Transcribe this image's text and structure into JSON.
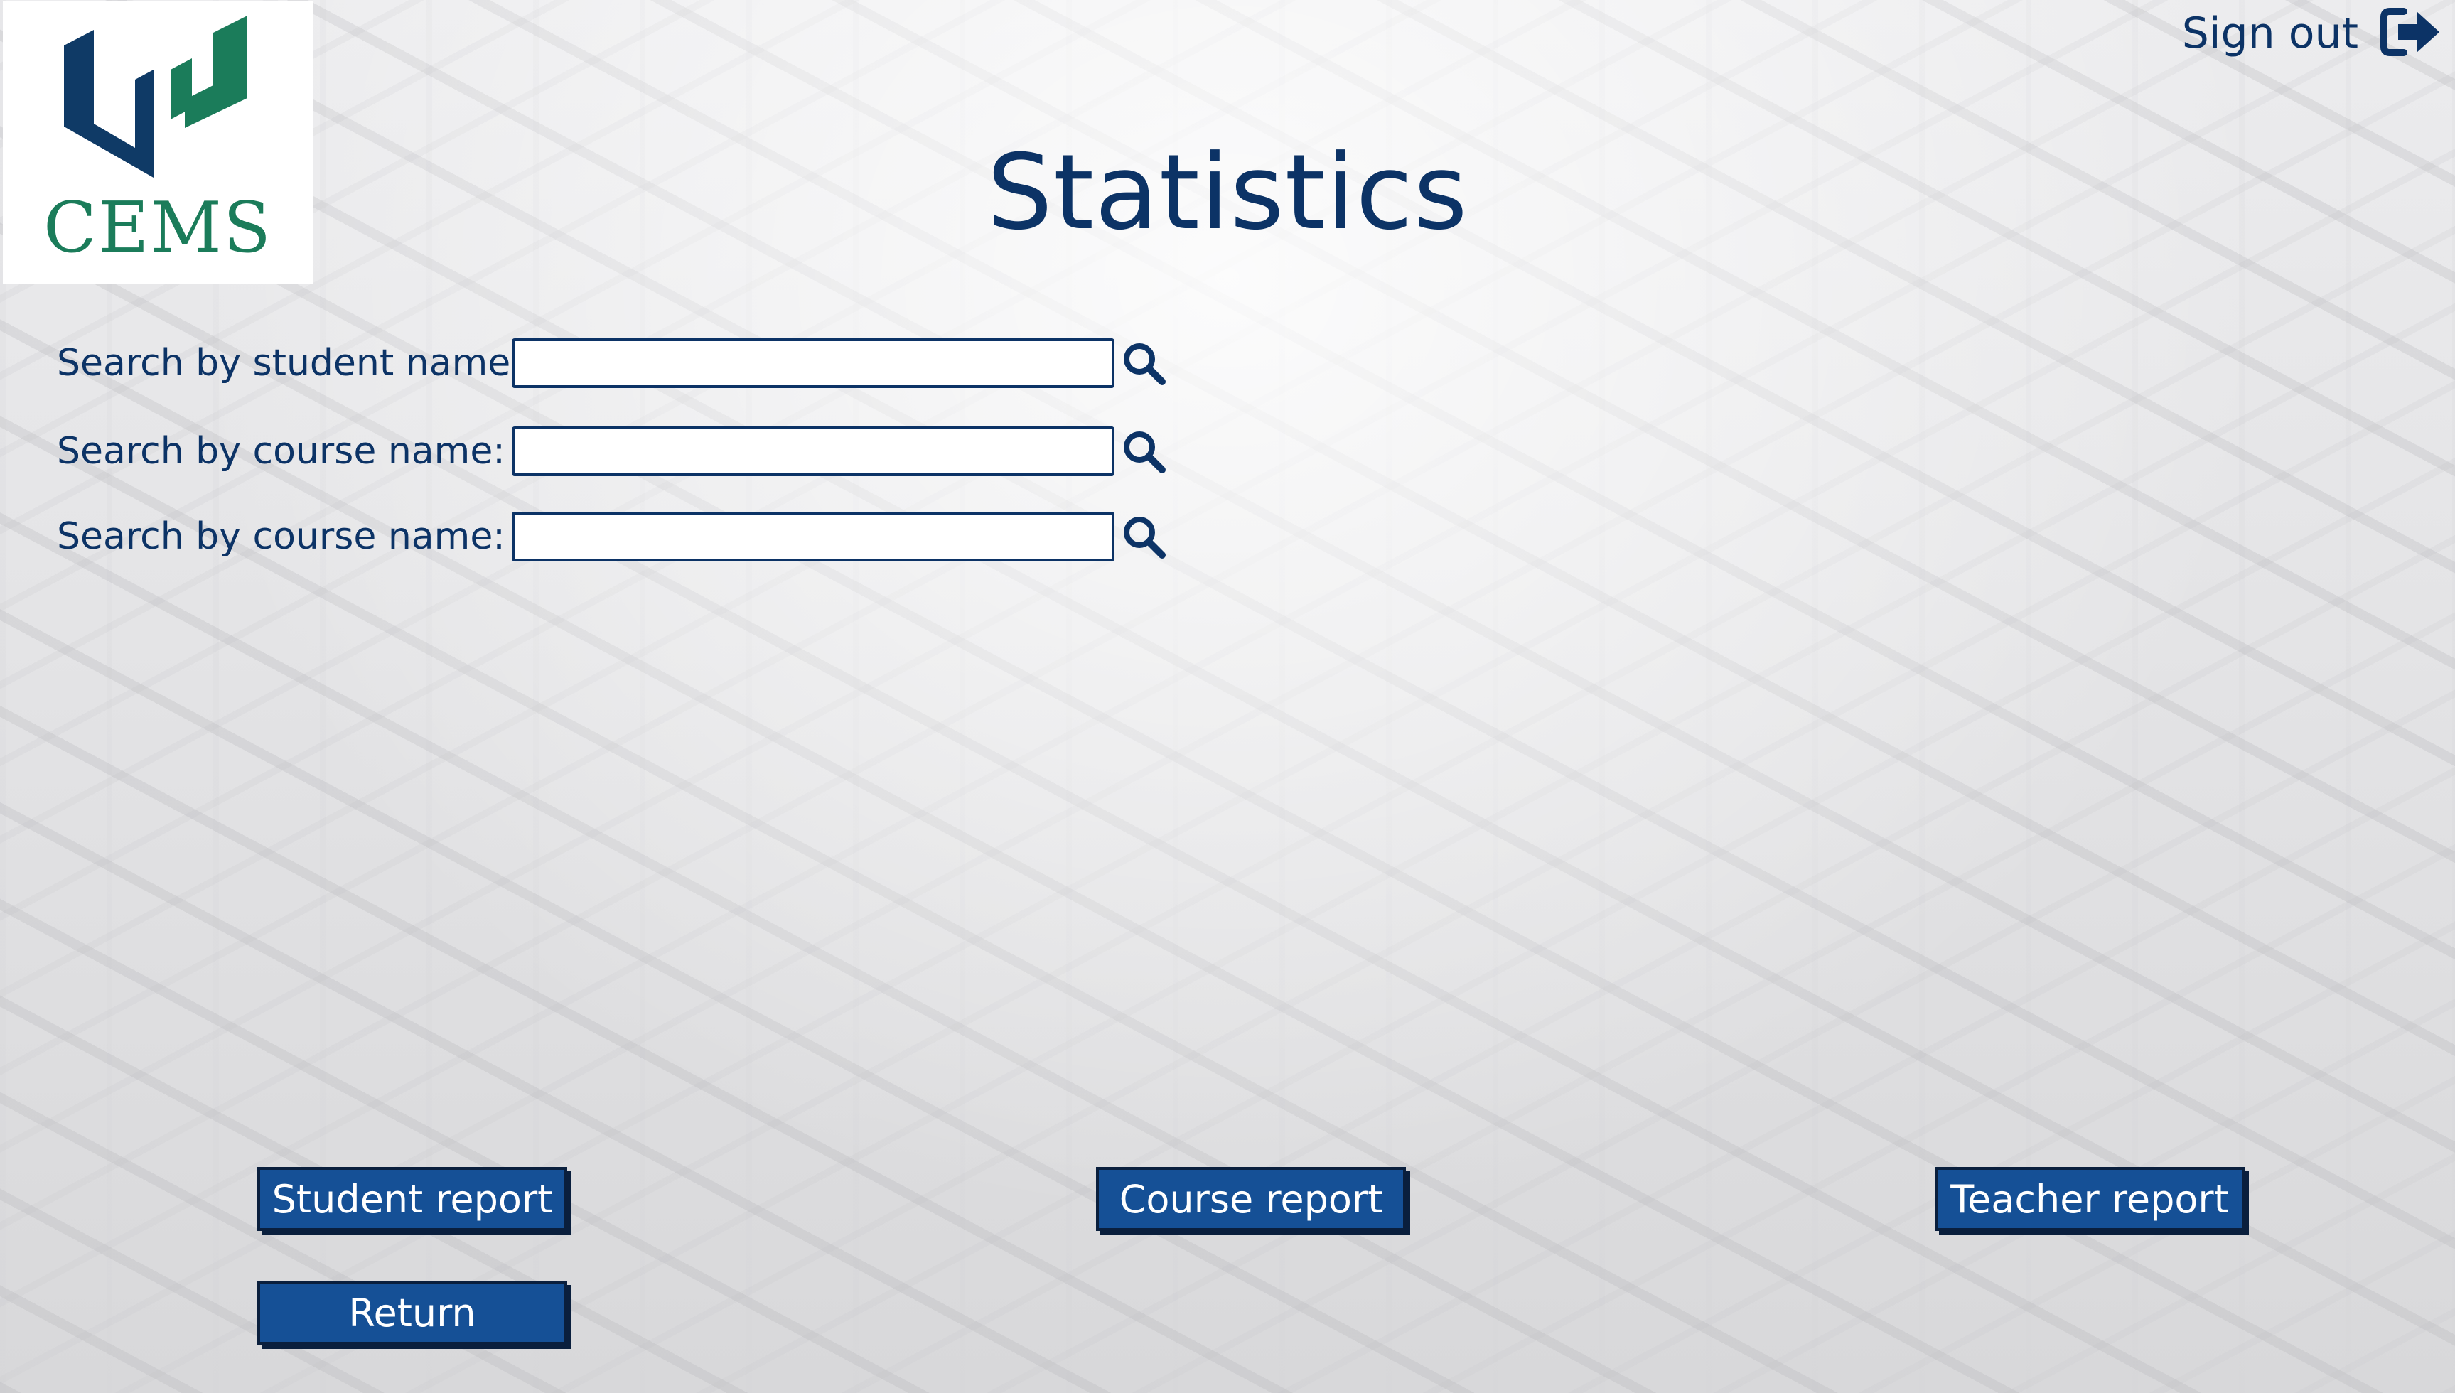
{
  "logo": {
    "text": "CEMS",
    "icon": "cems-logo-icon"
  },
  "header": {
    "title": "Statistics",
    "signout_label": "Sign out",
    "signout_icon": "sign-out-icon"
  },
  "search": {
    "rows": [
      {
        "label": "Search by student name:",
        "value": "",
        "icon": "search-icon"
      },
      {
        "label": "Search by course name:",
        "value": "",
        "icon": "search-icon"
      },
      {
        "label": "Search by course name:",
        "value": "",
        "icon": "search-icon"
      }
    ]
  },
  "buttons": {
    "student_report": "Student report",
    "course_report": "Course report",
    "teacher_report": "Teacher report",
    "return": "Return"
  },
  "colors": {
    "primary_text": "#0c3366",
    "button_bg": "#155096",
    "logo_navy": "#0f3a66",
    "logo_green": "#1b7c5a"
  }
}
